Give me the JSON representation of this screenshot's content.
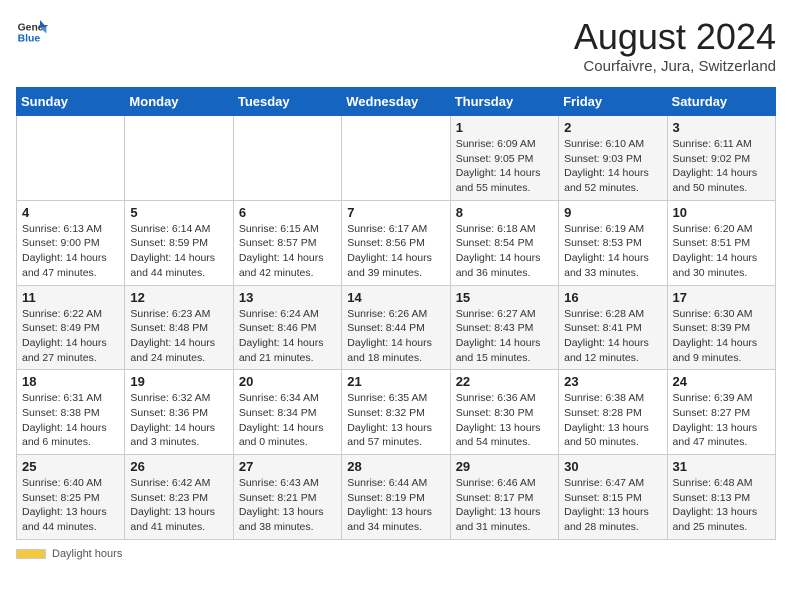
{
  "header": {
    "logo_general": "General",
    "logo_blue": "Blue",
    "title": "August 2024",
    "subtitle": "Courfaivre, Jura, Switzerland"
  },
  "weekdays": [
    "Sunday",
    "Monday",
    "Tuesday",
    "Wednesday",
    "Thursday",
    "Friday",
    "Saturday"
  ],
  "footer": {
    "daylight_label": "Daylight hours"
  },
  "weeks": [
    [
      {
        "day": "",
        "info": ""
      },
      {
        "day": "",
        "info": ""
      },
      {
        "day": "",
        "info": ""
      },
      {
        "day": "",
        "info": ""
      },
      {
        "day": "1",
        "info": "Sunrise: 6:09 AM\nSunset: 9:05 PM\nDaylight: 14 hours and 55 minutes."
      },
      {
        "day": "2",
        "info": "Sunrise: 6:10 AM\nSunset: 9:03 PM\nDaylight: 14 hours and 52 minutes."
      },
      {
        "day": "3",
        "info": "Sunrise: 6:11 AM\nSunset: 9:02 PM\nDaylight: 14 hours and 50 minutes."
      }
    ],
    [
      {
        "day": "4",
        "info": "Sunrise: 6:13 AM\nSunset: 9:00 PM\nDaylight: 14 hours and 47 minutes."
      },
      {
        "day": "5",
        "info": "Sunrise: 6:14 AM\nSunset: 8:59 PM\nDaylight: 14 hours and 44 minutes."
      },
      {
        "day": "6",
        "info": "Sunrise: 6:15 AM\nSunset: 8:57 PM\nDaylight: 14 hours and 42 minutes."
      },
      {
        "day": "7",
        "info": "Sunrise: 6:17 AM\nSunset: 8:56 PM\nDaylight: 14 hours and 39 minutes."
      },
      {
        "day": "8",
        "info": "Sunrise: 6:18 AM\nSunset: 8:54 PM\nDaylight: 14 hours and 36 minutes."
      },
      {
        "day": "9",
        "info": "Sunrise: 6:19 AM\nSunset: 8:53 PM\nDaylight: 14 hours and 33 minutes."
      },
      {
        "day": "10",
        "info": "Sunrise: 6:20 AM\nSunset: 8:51 PM\nDaylight: 14 hours and 30 minutes."
      }
    ],
    [
      {
        "day": "11",
        "info": "Sunrise: 6:22 AM\nSunset: 8:49 PM\nDaylight: 14 hours and 27 minutes."
      },
      {
        "day": "12",
        "info": "Sunrise: 6:23 AM\nSunset: 8:48 PM\nDaylight: 14 hours and 24 minutes."
      },
      {
        "day": "13",
        "info": "Sunrise: 6:24 AM\nSunset: 8:46 PM\nDaylight: 14 hours and 21 minutes."
      },
      {
        "day": "14",
        "info": "Sunrise: 6:26 AM\nSunset: 8:44 PM\nDaylight: 14 hours and 18 minutes."
      },
      {
        "day": "15",
        "info": "Sunrise: 6:27 AM\nSunset: 8:43 PM\nDaylight: 14 hours and 15 minutes."
      },
      {
        "day": "16",
        "info": "Sunrise: 6:28 AM\nSunset: 8:41 PM\nDaylight: 14 hours and 12 minutes."
      },
      {
        "day": "17",
        "info": "Sunrise: 6:30 AM\nSunset: 8:39 PM\nDaylight: 14 hours and 9 minutes."
      }
    ],
    [
      {
        "day": "18",
        "info": "Sunrise: 6:31 AM\nSunset: 8:38 PM\nDaylight: 14 hours and 6 minutes."
      },
      {
        "day": "19",
        "info": "Sunrise: 6:32 AM\nSunset: 8:36 PM\nDaylight: 14 hours and 3 minutes."
      },
      {
        "day": "20",
        "info": "Sunrise: 6:34 AM\nSunset: 8:34 PM\nDaylight: 14 hours and 0 minutes."
      },
      {
        "day": "21",
        "info": "Sunrise: 6:35 AM\nSunset: 8:32 PM\nDaylight: 13 hours and 57 minutes."
      },
      {
        "day": "22",
        "info": "Sunrise: 6:36 AM\nSunset: 8:30 PM\nDaylight: 13 hours and 54 minutes."
      },
      {
        "day": "23",
        "info": "Sunrise: 6:38 AM\nSunset: 8:28 PM\nDaylight: 13 hours and 50 minutes."
      },
      {
        "day": "24",
        "info": "Sunrise: 6:39 AM\nSunset: 8:27 PM\nDaylight: 13 hours and 47 minutes."
      }
    ],
    [
      {
        "day": "25",
        "info": "Sunrise: 6:40 AM\nSunset: 8:25 PM\nDaylight: 13 hours and 44 minutes."
      },
      {
        "day": "26",
        "info": "Sunrise: 6:42 AM\nSunset: 8:23 PM\nDaylight: 13 hours and 41 minutes."
      },
      {
        "day": "27",
        "info": "Sunrise: 6:43 AM\nSunset: 8:21 PM\nDaylight: 13 hours and 38 minutes."
      },
      {
        "day": "28",
        "info": "Sunrise: 6:44 AM\nSunset: 8:19 PM\nDaylight: 13 hours and 34 minutes."
      },
      {
        "day": "29",
        "info": "Sunrise: 6:46 AM\nSunset: 8:17 PM\nDaylight: 13 hours and 31 minutes."
      },
      {
        "day": "30",
        "info": "Sunrise: 6:47 AM\nSunset: 8:15 PM\nDaylight: 13 hours and 28 minutes."
      },
      {
        "day": "31",
        "info": "Sunrise: 6:48 AM\nSunset: 8:13 PM\nDaylight: 13 hours and 25 minutes."
      }
    ]
  ]
}
